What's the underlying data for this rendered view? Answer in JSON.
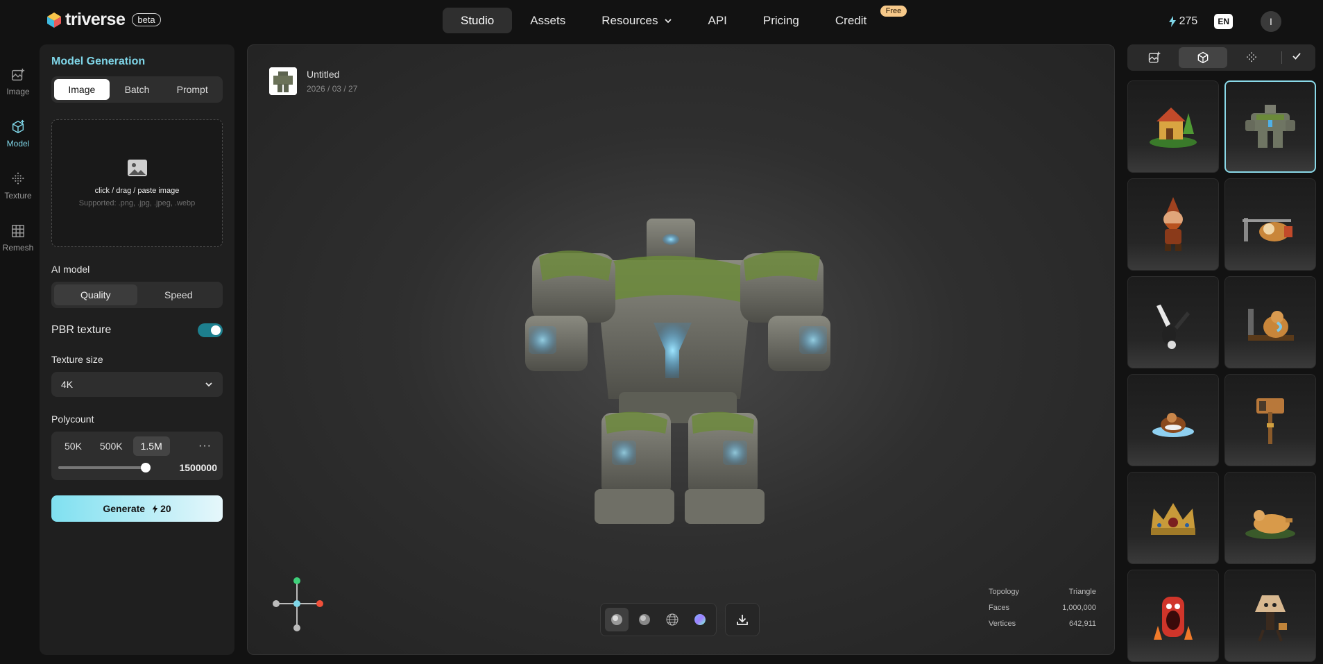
{
  "brand": {
    "name": "triverse",
    "badge": "beta"
  },
  "nav": {
    "items": [
      "Studio",
      "Assets",
      "Resources",
      "API",
      "Pricing",
      "Credit"
    ],
    "active": "Studio",
    "free_badge": "Free"
  },
  "header": {
    "credits": "275",
    "lang": "EN",
    "avatar": "I"
  },
  "rail": [
    {
      "label": "Image",
      "icon": "image-plus-icon"
    },
    {
      "label": "Model",
      "icon": "cube-icon",
      "active": true
    },
    {
      "label": "Texture",
      "icon": "texture-icon"
    },
    {
      "label": "Remesh",
      "icon": "grid-icon"
    }
  ],
  "panel": {
    "title": "Model Generation",
    "modes": [
      "Image",
      "Batch",
      "Prompt"
    ],
    "upload_text": "click / drag / paste image",
    "upload_sub": "Supported: .png, .jpg, .jpeg, .webp",
    "ai_model_label": "AI model",
    "ai_models": [
      "Quality",
      "Speed"
    ],
    "pbr_label": "PBR texture",
    "pbr_enabled": true,
    "texture_size_label": "Texture size",
    "texture_size": "4K",
    "polycount_label": "Polycount",
    "polycount_opts": [
      "50K",
      "500K",
      "1.5M"
    ],
    "polycount_more": "···",
    "polycount_value": "1500000",
    "generate_label": "Generate",
    "generate_cost": "20"
  },
  "viewport": {
    "name": "Untitled",
    "date": "2026 / 03 / 27",
    "stats": [
      {
        "k": "Topology",
        "v": "Triangle"
      },
      {
        "k": "Faces",
        "v": "1,000,000"
      },
      {
        "k": "Vertices",
        "v": "642,911"
      }
    ]
  },
  "colors": {
    "accent": "#7fd6e8",
    "toggle": "#1d7f8e",
    "free": "#f7c98a"
  }
}
